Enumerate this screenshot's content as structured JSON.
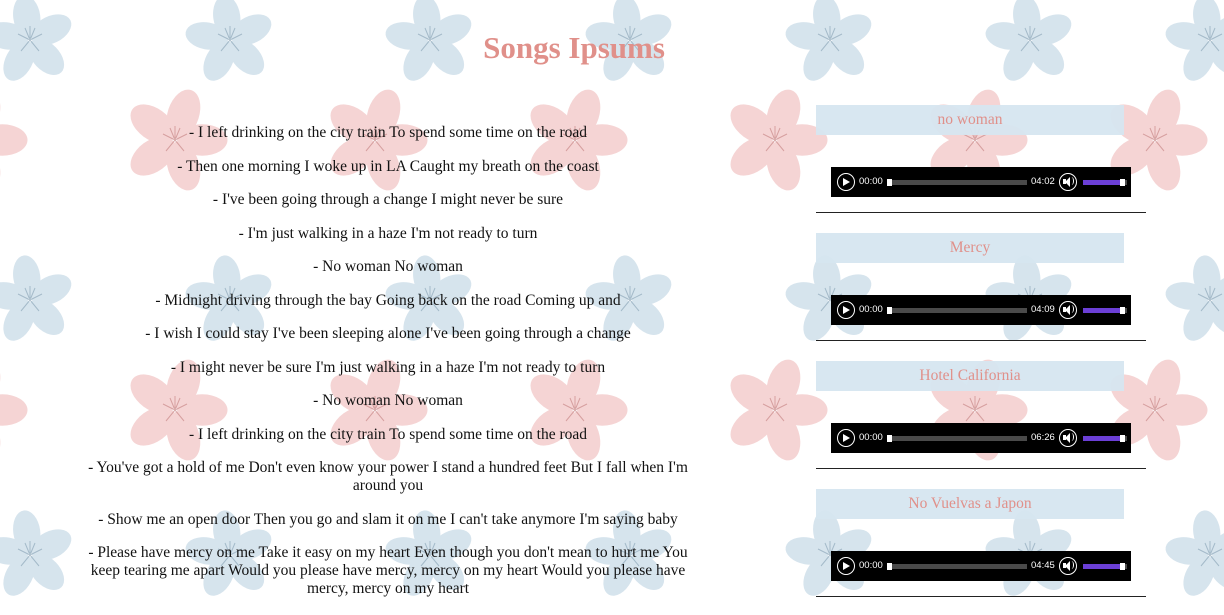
{
  "page": {
    "title": "Songs Ipsums"
  },
  "lyrics": [
    "- I left drinking on the city train To spend some time on the road",
    "- Then one morning I woke up in LA Caught my breath on the coast",
    "- I've been going through a change I might never be sure",
    "- I'm just walking in a haze I'm not ready to turn",
    "- No woman No woman",
    "- Midnight driving through the bay Going back on the road Coming up and",
    "- I wish I could stay I've been sleeping alone I've been going through a change",
    "- I might never be sure I'm just walking in a haze I'm not ready to turn",
    "- No woman No woman",
    "- I left drinking on the city train To spend some time on the road",
    "- You've got a hold of me Don't even know your power I stand a hundred feet But I fall when I'm around you",
    "- Show me an open door Then you go and slam it on me I can't take anymore I'm saying baby",
    "- Please have mercy on me Take it easy on my heart Even though you don't mean to hurt me You keep tearing me apart Would you please have mercy, mercy on my heart Would you please have mercy, mercy on my heart"
  ],
  "tracks": [
    {
      "title": "no woman",
      "current_time": "00:00",
      "duration": "04:02",
      "progress": 0,
      "volume": 0.9
    },
    {
      "title": "Mercy",
      "current_time": "00:00",
      "duration": "04:09",
      "progress": 0,
      "volume": 0.9
    },
    {
      "title": "Hotel California",
      "current_time": "00:00",
      "duration": "06:26",
      "progress": 0,
      "volume": 0.9
    },
    {
      "title": "No Vuelvas a Japon",
      "current_time": "00:00",
      "duration": "04:45",
      "progress": 0,
      "volume": 0.9
    }
  ],
  "colors": {
    "title": "#e0908a",
    "track_label_bg": "#d6e6f0",
    "player_bg": "#000000",
    "volume_fill": "#6b3fd6",
    "blossom_pink": "#f2c6c6",
    "blossom_blue": "#c9dbe7"
  },
  "icons": {
    "background": "cherry-blossom-pattern",
    "play": "play-icon",
    "volume": "speaker-icon"
  }
}
